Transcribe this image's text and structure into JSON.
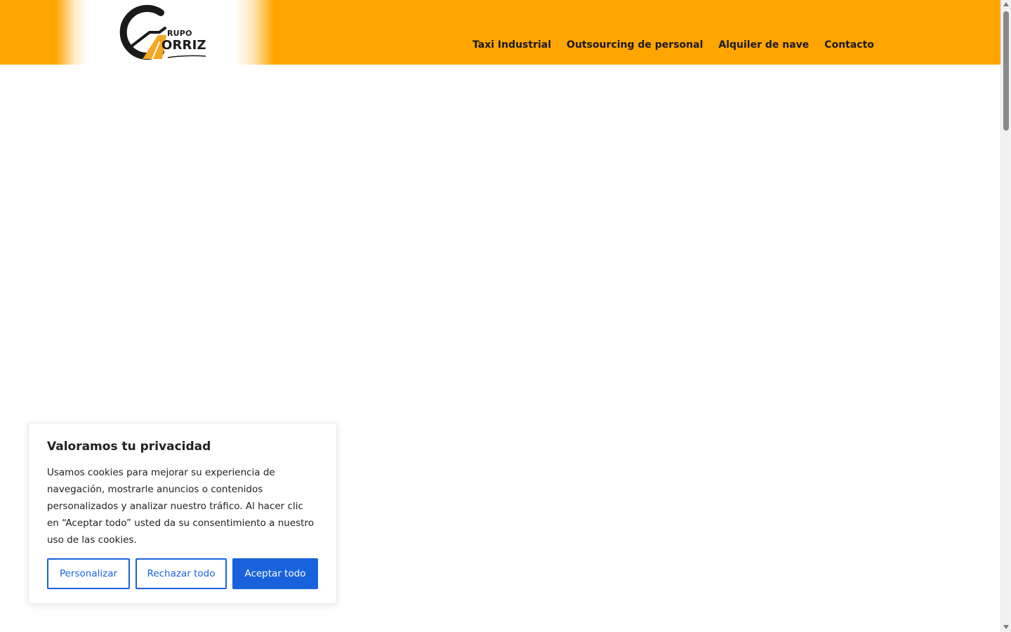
{
  "header": {
    "background_color": "#FFA500",
    "logo": {
      "text_small": "RUPO",
      "text_big": "ORRIZ",
      "colors": {
        "dark": "#1a1a1a",
        "accent": "#F5A623"
      }
    },
    "nav": [
      {
        "label": "Taxi Industrial"
      },
      {
        "label": "Outsourcing de personal"
      },
      {
        "label": "Alquiler de nave"
      },
      {
        "label": "Contacto"
      }
    ]
  },
  "cookie_banner": {
    "title": "Valoramos tu privacidad",
    "message": "Usamos cookies para mejorar su experiencia de navegación, mostrarle anuncios o contenidos personalizados y analizar nuestro tráfico. Al hacer clic en “Aceptar todo” usted da su consentimiento a nuestro uso de las cookies.",
    "buttons": {
      "customize": "Personalizar",
      "reject": "Rechazar todo",
      "accept": "Aceptar todo"
    },
    "accent_color": "#1863DC"
  }
}
